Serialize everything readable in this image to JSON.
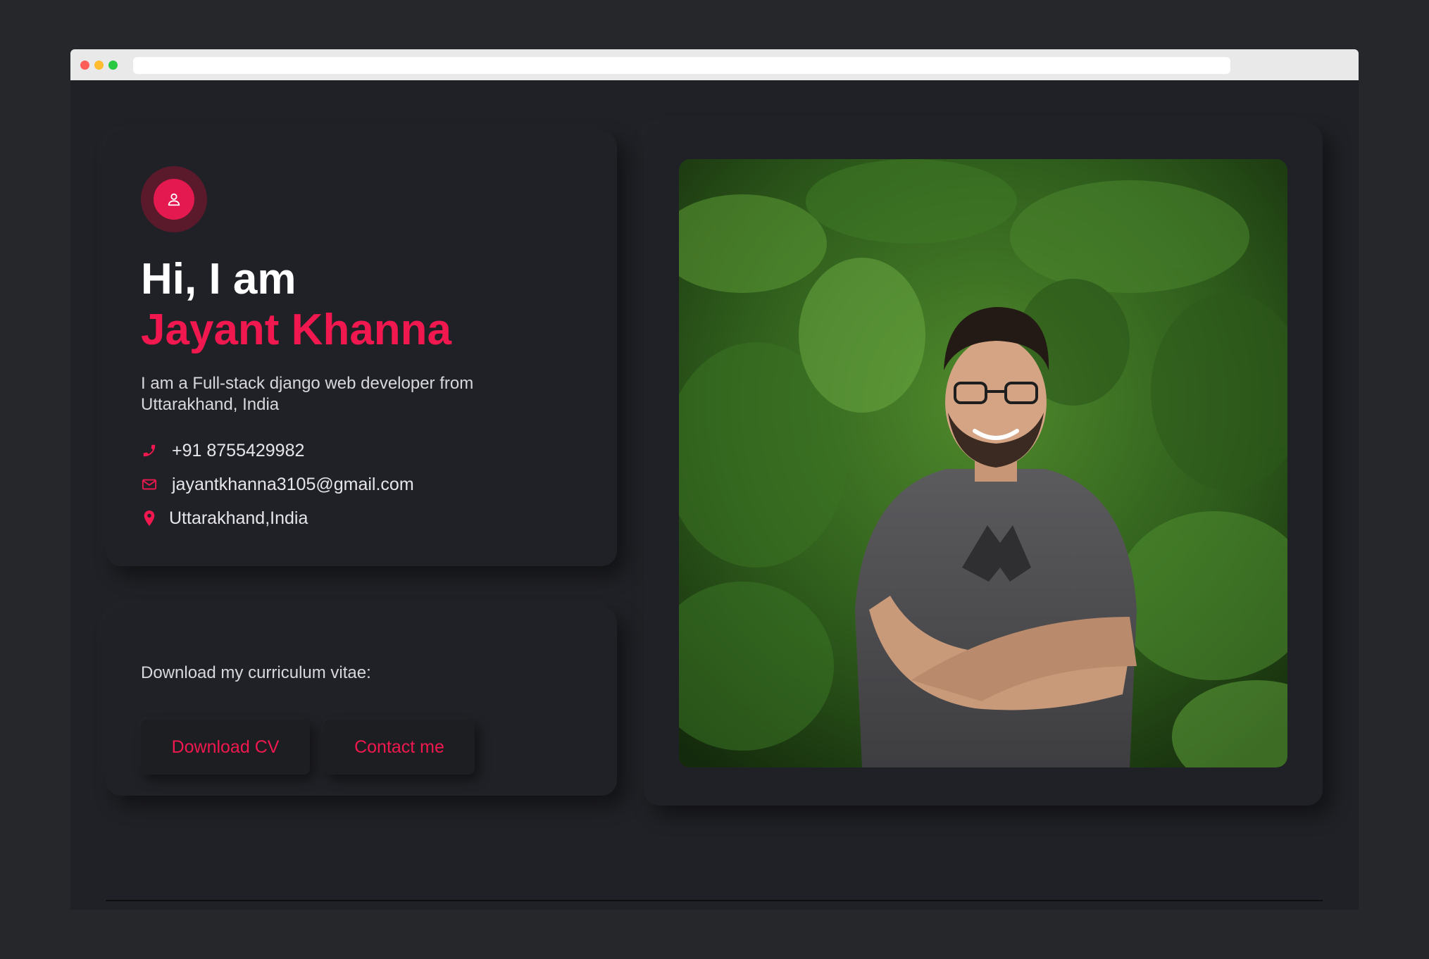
{
  "intro": {
    "greeting": "Hi, I am",
    "name": "Jayant Khanna",
    "bio": "I am a Full-stack django web developer from Uttarakhand, India",
    "avatar_icon": "user-icon",
    "contacts": {
      "phone": {
        "icon": "phone-icon",
        "text": "+91 8755429982"
      },
      "email": {
        "icon": "envelope-icon",
        "text": "jayantkhanna3105@gmail.com"
      },
      "location": {
        "icon": "map-pin-icon",
        "text": "Uttarakhand,India"
      }
    }
  },
  "cv": {
    "prompt": "Download my curriculum vitae:",
    "download_label": "Download CV",
    "contact_label": "Contact me"
  },
  "theme": {
    "accent": "#f0184f",
    "background": "#202126",
    "text": "#ffffff"
  }
}
